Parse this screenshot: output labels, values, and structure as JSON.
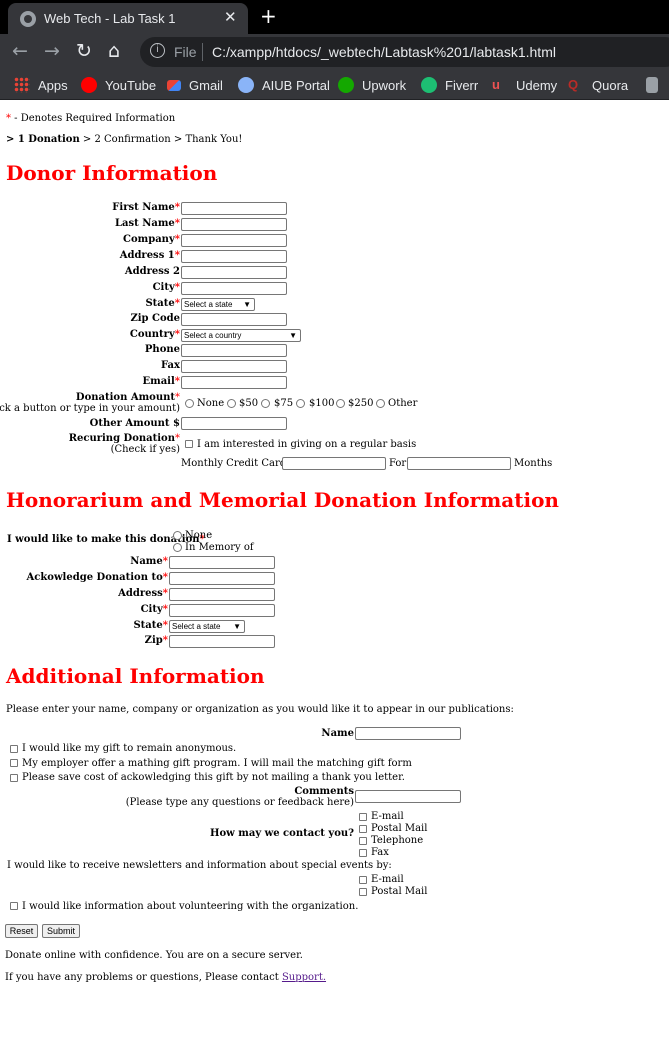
{
  "browser": {
    "tab_title": "Web Tech - Lab Task 1",
    "close_glyph": "✕",
    "new_tab_glyph": "+",
    "file_label": "File",
    "url": "C:/xampp/htdocs/_webtech/Labtask%201/labtask1.html",
    "bookmarks": [
      "Apps",
      "YouTube",
      "Gmail",
      "AIUB Portal",
      "Upwork",
      "Fiverr",
      "Udemy",
      "Quora"
    ]
  },
  "page": {
    "required_star": "*",
    "required_note": " - Denotes Required Information",
    "steps": {
      "current": "> 1 Donation",
      "rest": " > 2 Confirmation > Thank You!"
    },
    "donor": {
      "heading": "Donor Information",
      "first_name": "First Name",
      "last_name": "Last Name",
      "company": "Company",
      "address1": "Address 1",
      "address2": "Address 2",
      "city": "City",
      "state": "State",
      "state_select": "Select a state",
      "zip": "Zip Code",
      "country": "Country",
      "country_select": "Select a country",
      "phone": "Phone",
      "fax": "Fax",
      "email": "Email",
      "donation_amount": "Donation Amount",
      "donation_hint": "(Check a button or type in your amount)",
      "amount_options": [
        "None",
        "$50",
        "$75",
        "$100",
        "$250",
        "Other"
      ],
      "other_amount": "Other Amount $",
      "recurring": "Recuring Donation",
      "recurring_hint": "(Check if yes)",
      "recurring_checkbox": "I am interested in giving on a regular basis",
      "monthly_cc": "Monthly Credit Card $",
      "for": "For",
      "months": "Months"
    },
    "honorarium": {
      "heading": "Honorarium and Memorial Donation Information",
      "make_donation": "I would like to make this donation",
      "options": [
        "None",
        "In Memory of"
      ],
      "name": "Name",
      "acknowledge": "Ackowledge Donation to",
      "address": "Address",
      "city": "City",
      "state": "State",
      "state_select": "Select a state",
      "zip": "Zip"
    },
    "additional": {
      "heading": "Additional Information",
      "intro": "Please enter your name, company or organization as you would like it to appear in our publications:",
      "name": "Name",
      "checks": [
        "I would like my gift to remain anonymous.",
        "My employer offer a mathing gift program. I will mail the matching gift form",
        "Please save cost of ackowledging this gift by not mailing a thank you letter."
      ],
      "comments": "Comments",
      "comments_hint": "(Please type any questions or feedback here)",
      "contact": "How may we contact you?",
      "contact_options": [
        "E-mail",
        "Postal Mail",
        "Telephone",
        "Fax"
      ],
      "newsletter": "I would like to receive newsletters and information about special events by:",
      "newsletter_options": [
        "E-mail",
        "Postal Mail"
      ],
      "volunteer": "I would like information about volunteering with the organization.",
      "reset": "Reset",
      "submit": "Submit",
      "secure": "Donate online with confidence. You are on a secure server.",
      "problems": "If you have any problems or questions, Please contact ",
      "support": "Support."
    }
  }
}
